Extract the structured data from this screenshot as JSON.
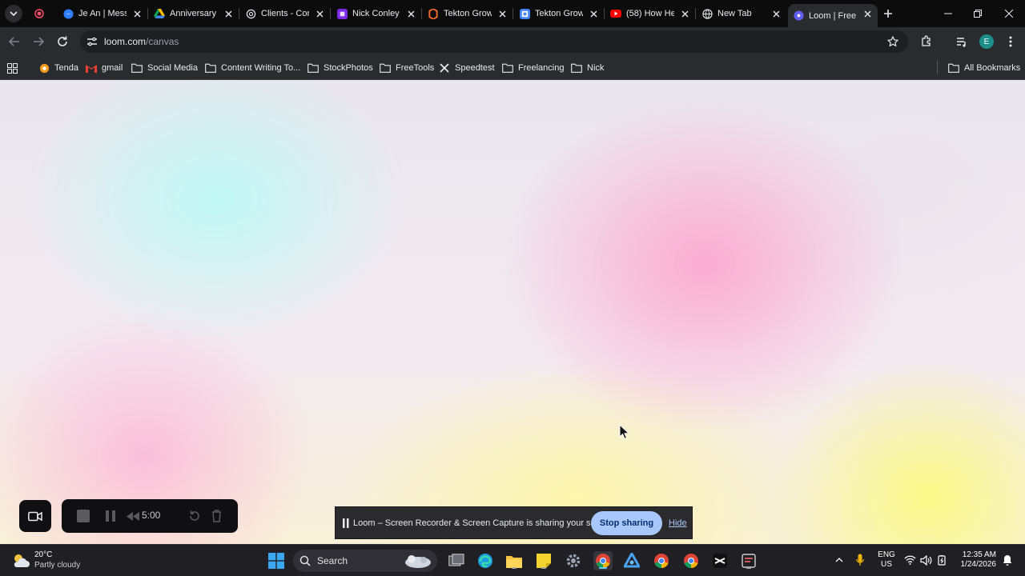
{
  "tabs": [
    {
      "title": "",
      "icon": "record-icon"
    },
    {
      "title": "Je An | Mess",
      "icon": "messenger-icon"
    },
    {
      "title": "Anniversary",
      "icon": "google-drive-icon"
    },
    {
      "title": "Clients - Cor",
      "icon": "chatgpt-icon"
    },
    {
      "title": "Nick Conley",
      "icon": "canva-icon"
    },
    {
      "title": "Tekton Grow",
      "icon": "tekton-icon"
    },
    {
      "title": "Tekton Grow",
      "icon": "google-docs-icon"
    },
    {
      "title": "(58) How He",
      "icon": "youtube-icon"
    },
    {
      "title": "New Tab",
      "icon": "globe-icon"
    },
    {
      "title": "Loom | Free",
      "icon": "loom-icon",
      "active": true
    }
  ],
  "address": {
    "host": "loom.com",
    "path": "/canvas"
  },
  "profile_initial": "E",
  "bookmarks": [
    {
      "label": "Tenda",
      "icon": "tenda-icon"
    },
    {
      "label": "gmail",
      "icon": "gmail-icon"
    },
    {
      "label": "Social Media",
      "icon": "folder-icon"
    },
    {
      "label": "Content Writing To...",
      "icon": "folder-icon"
    },
    {
      "label": "StockPhotos",
      "icon": "folder-icon"
    },
    {
      "label": "FreeTools",
      "icon": "folder-icon"
    },
    {
      "label": "Speedtest",
      "icon": "x-logo-icon"
    },
    {
      "label": "Freelancing",
      "icon": "folder-icon"
    },
    {
      "label": "Nick",
      "icon": "folder-icon"
    }
  ],
  "all_bookmarks": "All Bookmarks",
  "recorder": {
    "time": "5:00"
  },
  "share_notice": {
    "message": "Loom – Screen Recorder & Screen Capture is sharing your screen.",
    "stop_label": "Stop sharing",
    "hide_label": "Hide"
  },
  "taskbar": {
    "weather_temp": "20°C",
    "weather_desc": "Partly cloudy",
    "search_label": "Search",
    "lang_line1": "ENG",
    "lang_line2": "US",
    "time": "12:35 AM",
    "date": "1/24/2026"
  },
  "colors": {
    "accent": "#a8c7fa",
    "chrome_bg": "#2a2b2e",
    "taskbar_bg": "#202024"
  }
}
